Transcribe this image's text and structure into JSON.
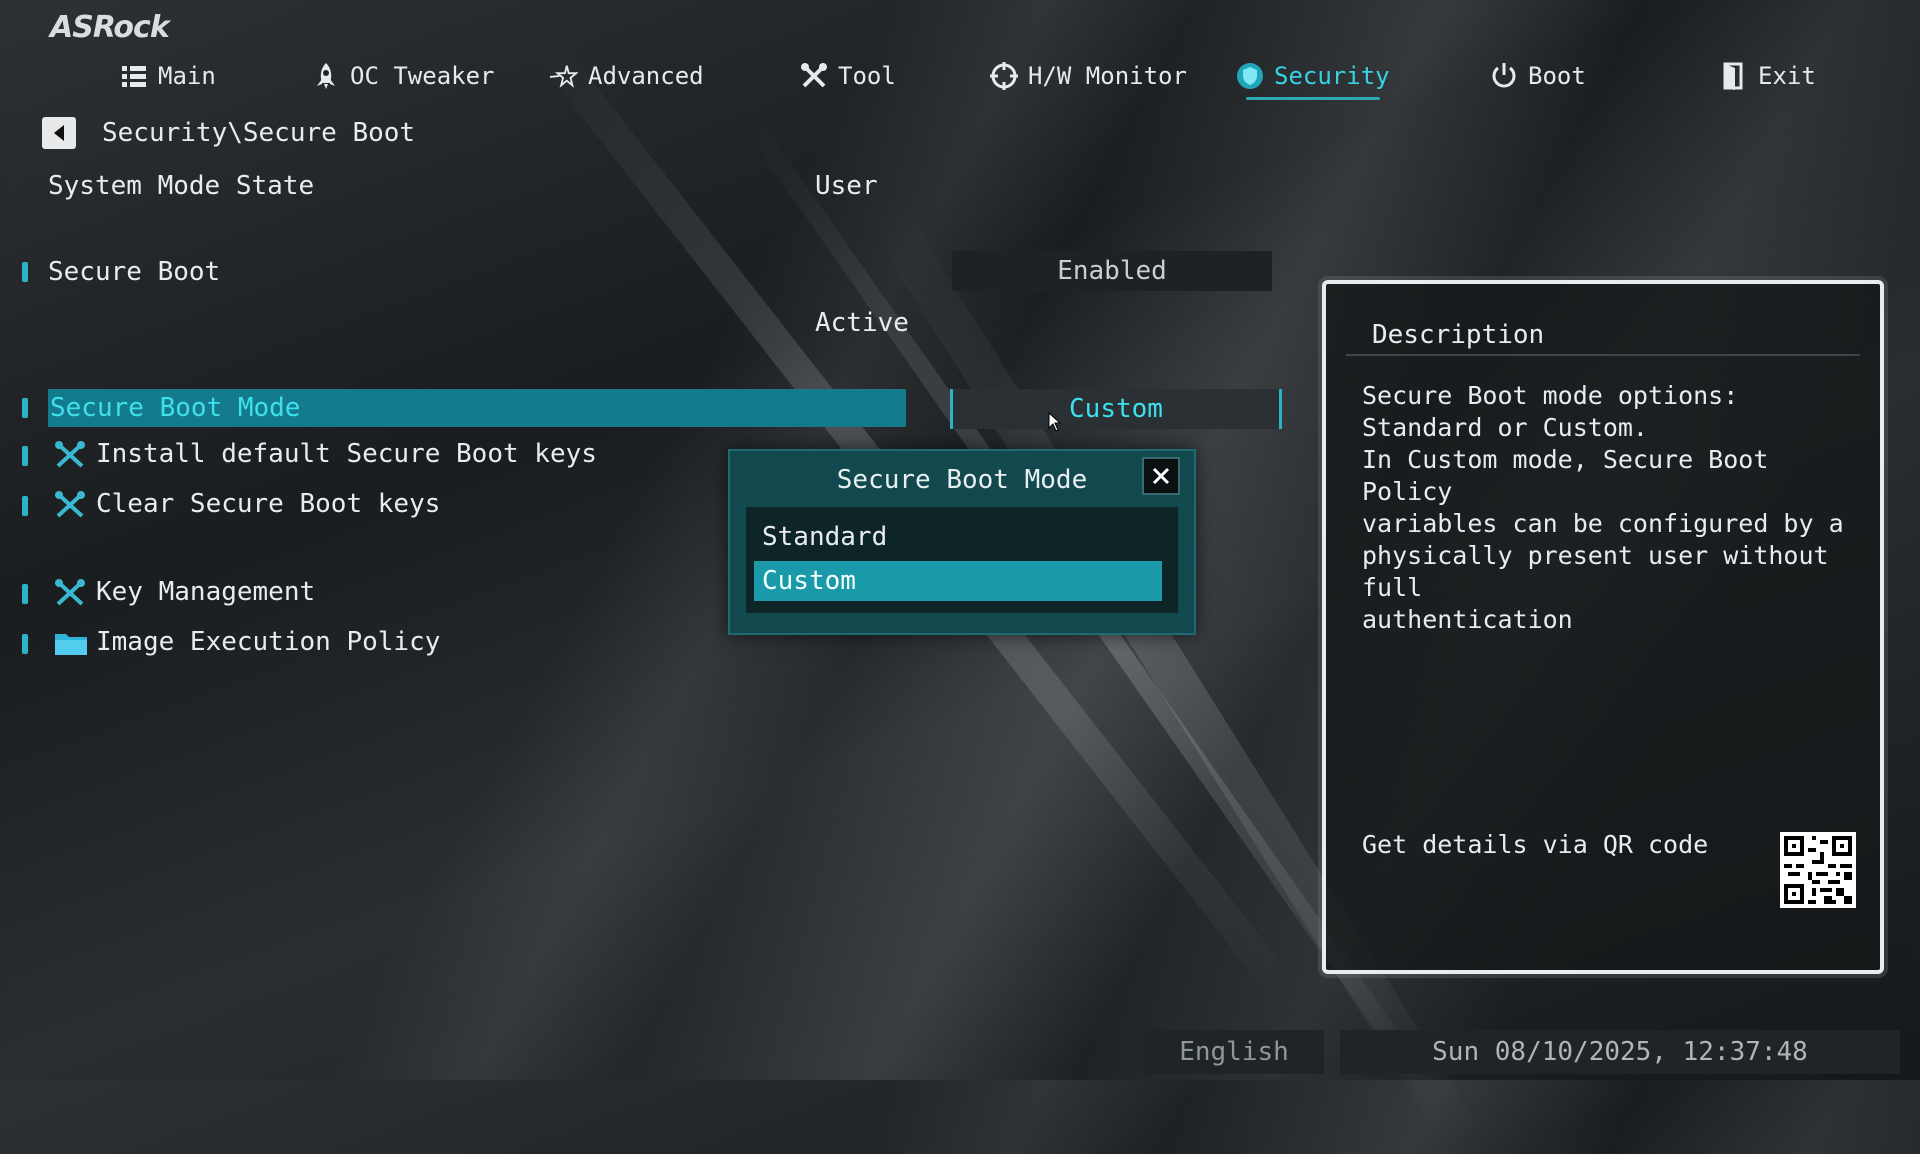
{
  "brand": "ASRock",
  "nav": [
    {
      "label": "Main",
      "icon": "list-icon"
    },
    {
      "label": "OC Tweaker",
      "icon": "rocket-icon"
    },
    {
      "label": "Advanced",
      "icon": "star-icon"
    },
    {
      "label": "Tool",
      "icon": "tools-icon"
    },
    {
      "label": "H/W Monitor",
      "icon": "crosshair-icon"
    },
    {
      "label": "Security",
      "icon": "shield-icon"
    },
    {
      "label": "Boot",
      "icon": "power-icon"
    },
    {
      "label": "Exit",
      "icon": "exit-door-icon"
    }
  ],
  "active_tab": "Security",
  "breadcrumb": "Security\\Secure Boot",
  "settings": {
    "system_mode_label": "System Mode State",
    "system_mode_value": "User",
    "secure_boot_label": "Secure Boot",
    "secure_boot_value": "Enabled",
    "secure_boot_status": "Active",
    "secure_boot_mode_label": "Secure Boot Mode",
    "secure_boot_mode_value": "Custom",
    "install_keys_label": "Install default Secure Boot keys",
    "clear_keys_label": "Clear Secure Boot keys",
    "key_management_label": "Key Management",
    "image_exec_label": "Image Execution Policy"
  },
  "popup": {
    "title": "Secure Boot Mode",
    "options": [
      "Standard",
      "Custom"
    ],
    "selected": "Custom"
  },
  "description": {
    "title": "Description",
    "text": "Secure Boot mode options:\nStandard or Custom.\nIn Custom mode, Secure Boot Policy\nvariables can be configured by a\nphysically present user without full\nauthentication",
    "qr_label": "Get details via QR code"
  },
  "footer": {
    "language": "English",
    "datetime": "Sun 08/10/2025, 12:37:48"
  },
  "colors": {
    "accent": "#36d3e3",
    "selection": "#137b8c",
    "popup_bg": "#11494f"
  }
}
